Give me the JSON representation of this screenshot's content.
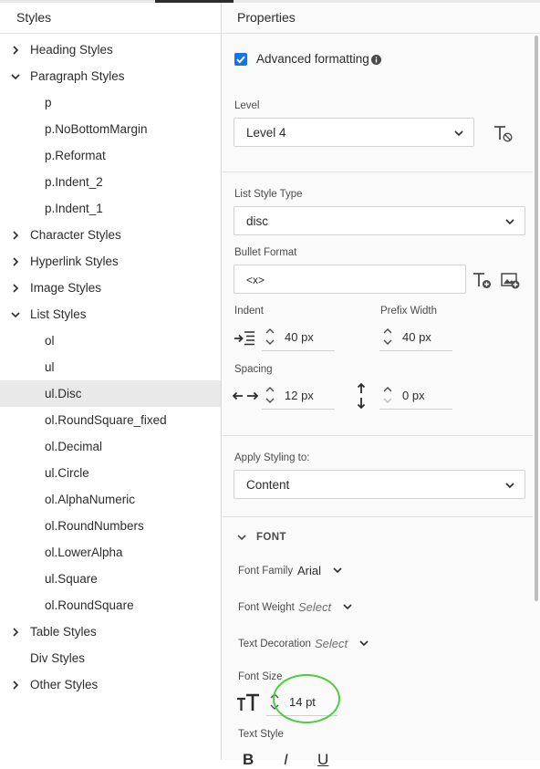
{
  "styles_panel": {
    "title": "Styles",
    "items": [
      {
        "label": "Heading Styles",
        "expandable": true,
        "expanded": false
      },
      {
        "label": "Paragraph Styles",
        "expandable": true,
        "expanded": true
      },
      {
        "label": "p"
      },
      {
        "label": "p.NoBottomMargin"
      },
      {
        "label": "p.Reformat"
      },
      {
        "label": "p.Indent_2"
      },
      {
        "label": "p.Indent_1"
      },
      {
        "label": "Character Styles",
        "expandable": true,
        "expanded": false
      },
      {
        "label": "Hyperlink Styles",
        "expandable": true,
        "expanded": false
      },
      {
        "label": "Image Styles",
        "expandable": true,
        "expanded": false
      },
      {
        "label": "List Styles",
        "expandable": true,
        "expanded": true
      },
      {
        "label": "ol"
      },
      {
        "label": "ul"
      },
      {
        "label": "ul.Disc",
        "selected": true
      },
      {
        "label": "ol.RoundSquare_fixed"
      },
      {
        "label": "ol.Decimal"
      },
      {
        "label": "ul.Circle"
      },
      {
        "label": "ol.AlphaNumeric"
      },
      {
        "label": "ol.RoundNumbers"
      },
      {
        "label": "ol.LowerAlpha"
      },
      {
        "label": "ul.Square"
      },
      {
        "label": "ol.RoundSquare"
      },
      {
        "label": "Table Styles",
        "expandable": true,
        "expanded": false
      },
      {
        "label": "Div Styles"
      },
      {
        "label": "Other Styles",
        "expandable": true,
        "expanded": false
      }
    ]
  },
  "properties_panel": {
    "title": "Properties",
    "advanced_formatting": {
      "label": "Advanced formatting",
      "checked": true
    },
    "level": {
      "label": "Level",
      "value": "Level 4"
    },
    "list_style_type": {
      "label": "List Style Type",
      "value": "disc"
    },
    "bullet_format": {
      "label": "Bullet Format",
      "value": "<x>"
    },
    "indent": {
      "label": "Indent",
      "value": "40 px"
    },
    "prefix_width": {
      "label": "Prefix Width",
      "value": "40 px"
    },
    "spacing_label": "Spacing",
    "spacing_horizontal": {
      "value": "12 px"
    },
    "spacing_vertical": {
      "value": "0 px"
    },
    "apply_styling": {
      "label": "Apply Styling to:",
      "value": "Content"
    },
    "font_section": {
      "title": "FONT",
      "font_family": {
        "label": "Font Family",
        "value": "Arial"
      },
      "font_weight": {
        "label": "Font Weight",
        "placeholder": "Select"
      },
      "text_decoration": {
        "label": "Text Decoration",
        "placeholder": "Select"
      },
      "font_size": {
        "label": "Font Size",
        "value": "14 pt"
      },
      "text_style": {
        "label": "Text Style"
      }
    }
  },
  "colors": {
    "accent": "#1473e6",
    "callout": "#4bcf3f",
    "selected_row": "#e9e9e9"
  }
}
